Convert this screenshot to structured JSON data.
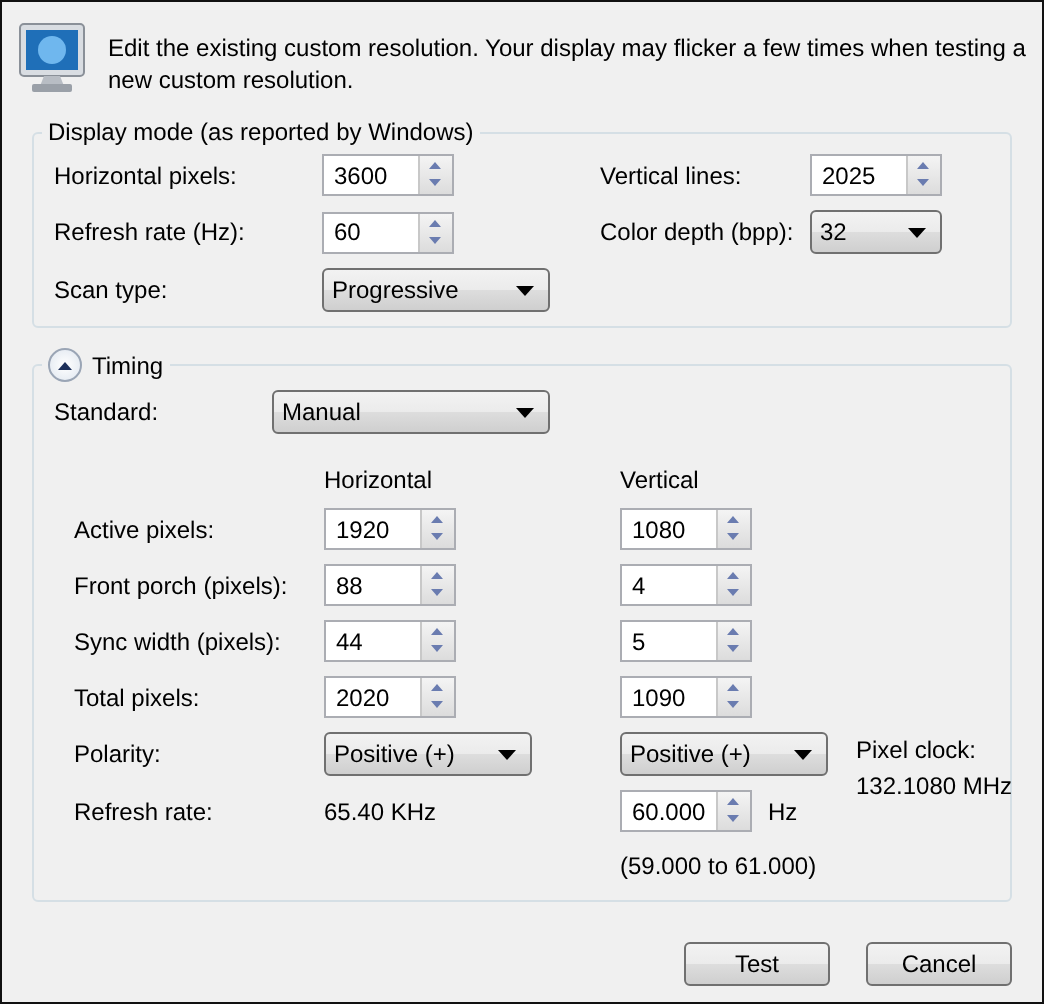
{
  "header": {
    "message": "Edit the existing custom resolution. Your display may flicker a few times when testing a new custom resolution."
  },
  "display_mode": {
    "title": "Display mode (as reported by Windows)",
    "fields": [
      {
        "label": "Horizontal pixels:",
        "kind": "spinner",
        "value": "3600"
      },
      {
        "label": "Vertical lines:",
        "kind": "spinner",
        "value": "2025"
      },
      {
        "label": "Refresh rate (Hz):",
        "kind": "spinner",
        "value": "60"
      },
      {
        "label": "Color depth (bpp):",
        "kind": "dropdown",
        "value": "32"
      },
      {
        "label": "Scan type:",
        "kind": "dropdown",
        "value": "Progressive"
      }
    ]
  },
  "timing": {
    "title": "Timing",
    "expanded": true,
    "standard": {
      "label": "Standard:",
      "value": "Manual"
    },
    "column_headers": [
      "Horizontal",
      "Vertical"
    ],
    "rows": [
      {
        "label": "Active pixels:",
        "horizontal": {
          "kind": "spinner",
          "value": "1920"
        },
        "vertical": {
          "kind": "spinner",
          "value": "1080"
        }
      },
      {
        "label": "Front porch (pixels):",
        "horizontal": {
          "kind": "spinner",
          "value": "88"
        },
        "vertical": {
          "kind": "spinner",
          "value": "4"
        }
      },
      {
        "label": "Sync width (pixels):",
        "horizontal": {
          "kind": "spinner",
          "value": "44"
        },
        "vertical": {
          "kind": "spinner",
          "value": "5"
        }
      },
      {
        "label": "Total pixels:",
        "horizontal": {
          "kind": "spinner",
          "value": "2020"
        },
        "vertical": {
          "kind": "spinner",
          "value": "1090"
        }
      },
      {
        "label": "Polarity:",
        "horizontal": {
          "kind": "dropdown",
          "value": "Positive (+)"
        },
        "vertical": {
          "kind": "dropdown",
          "value": "Positive (+)"
        }
      },
      {
        "label": "Refresh rate:",
        "horizontal": {
          "kind": "text",
          "value": "65.40 KHz"
        },
        "vertical": {
          "kind": "spinner",
          "value": "60.000",
          "unit": "Hz",
          "note": "(59.000 to 61.000)"
        }
      }
    ],
    "pixel_clock": {
      "label": "Pixel clock:",
      "value": "132.1080 MHz"
    }
  },
  "buttons": [
    "Test",
    "Cancel"
  ]
}
